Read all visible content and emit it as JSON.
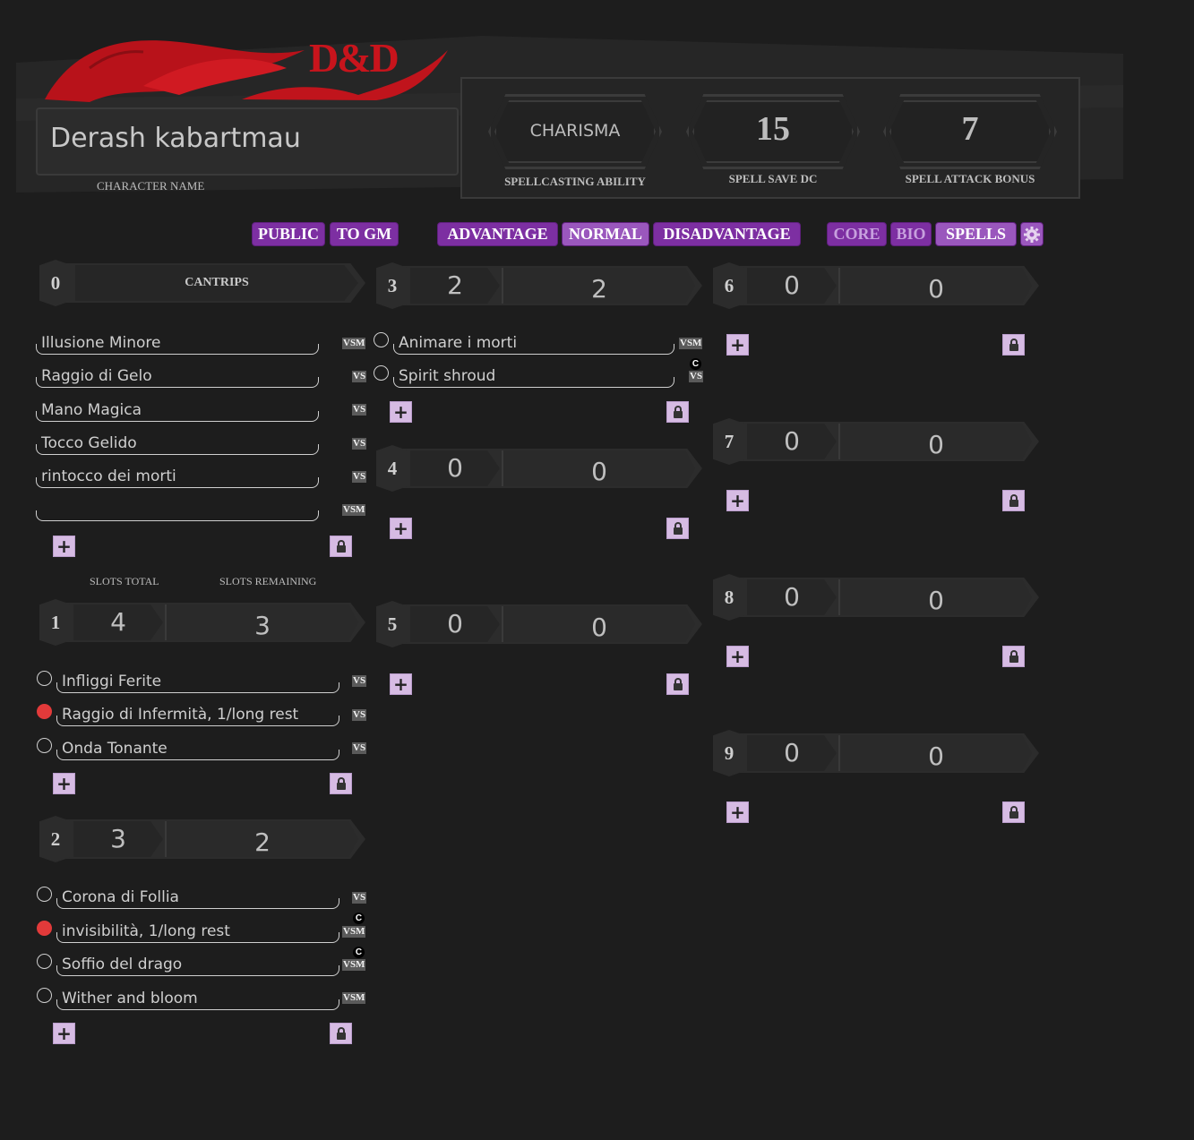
{
  "header": {
    "logo": "D&D",
    "character_name": "Derash kabartmau",
    "character_name_label": "CHARACTER NAME",
    "spellcasting_ability": "CHARISMA",
    "spellcasting_ability_label": "SPELLCASTING ABILITY",
    "spell_save_dc": "15",
    "spell_save_dc_label": "SPELL SAVE DC",
    "spell_attack_bonus": "7",
    "spell_attack_bonus_label": "SPELL ATTACK BONUS"
  },
  "toolbar": {
    "public": "PUBLIC",
    "to_gm": "TO GM",
    "advantage": "ADVANTAGE",
    "normal": "NORMAL",
    "disadvantage": "DISADVANTAGE",
    "core": "CORE",
    "bio": "BIO",
    "spells": "SPELLS",
    "settings_icon": "gear-icon"
  },
  "colors": {
    "accent": "#7d2fa2",
    "prepared": "#e23a3a",
    "add_button": "#d6bbe3",
    "logo_red": "#c8141c"
  },
  "cantrips": {
    "level": "0",
    "title": "CANTRIPS",
    "spells": [
      {
        "name": "Illusione Minore",
        "comp": "VSM"
      },
      {
        "name": "Raggio di Gelo",
        "comp": "VS"
      },
      {
        "name": "Mano Magica",
        "comp": "VS"
      },
      {
        "name": "Tocco Gelido",
        "comp": "VS"
      },
      {
        "name": "rintocco dei morti",
        "comp": "VS"
      },
      {
        "name": "",
        "comp": "VSM"
      }
    ]
  },
  "slot_labels": {
    "total": "SLOTS TOTAL",
    "remaining": "SLOTS REMAINING"
  },
  "levels": [
    {
      "level": "1",
      "total": "4",
      "remaining": "3",
      "spells": [
        {
          "name": "Infliggi Ferite",
          "comp": "VS",
          "prepared": false,
          "conc": ""
        },
        {
          "name": "Raggio di Infermità, 1/long rest",
          "comp": "VS",
          "prepared": true,
          "conc": ""
        },
        {
          "name": "Onda Tonante",
          "comp": "VS",
          "prepared": false,
          "conc": ""
        }
      ]
    },
    {
      "level": "2",
      "total": "3",
      "remaining": "2",
      "spells": [
        {
          "name": "Corona di Follia",
          "comp": "VS",
          "prepared": false,
          "conc": ""
        },
        {
          "name": "invisibilità, 1/long rest",
          "comp": "VSM",
          "prepared": true,
          "conc": "C"
        },
        {
          "name": "Soffio del drago",
          "comp": "VSM",
          "prepared": false,
          "conc": "C"
        },
        {
          "name": "Wither and bloom",
          "comp": "VSM",
          "prepared": false,
          "conc": ""
        }
      ]
    },
    {
      "level": "3",
      "total": "2",
      "remaining": "2",
      "spells": [
        {
          "name": "Animare i morti",
          "comp": "VSM",
          "prepared": false,
          "conc": ""
        },
        {
          "name": "Spirit shroud",
          "comp": "VS",
          "prepared": false,
          "conc": "C"
        }
      ]
    },
    {
      "level": "4",
      "total": "0",
      "remaining": "0",
      "spells": []
    },
    {
      "level": "5",
      "total": "0",
      "remaining": "0",
      "spells": []
    },
    {
      "level": "6",
      "total": "0",
      "remaining": "0",
      "spells": []
    },
    {
      "level": "7",
      "total": "0",
      "remaining": "0",
      "spells": []
    },
    {
      "level": "8",
      "total": "0",
      "remaining": "0",
      "spells": []
    },
    {
      "level": "9",
      "total": "0",
      "remaining": "0",
      "spells": []
    }
  ]
}
